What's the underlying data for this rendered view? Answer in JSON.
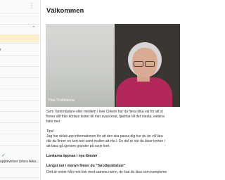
{
  "sidebar": {
    "more_menu": "⋮",
    "items": [
      {
        "label": ""
      },
      {
        "label": ""
      },
      {
        "label": ""
      },
      {
        "label": "r"
      },
      {
        "label": ""
      },
      {
        "label": ""
      },
      {
        "label": ""
      },
      {
        "label": ""
      },
      {
        "label": ""
      },
      {
        "label": ""
      },
      {
        "label": ""
      },
      {
        "label": "",
        "done": true
      },
      {
        "label": "upplevelser (stora Arka..."
      },
      {
        "label": ""
      },
      {
        "label": ""
      }
    ]
  },
  "page": {
    "title": "Välkommen",
    "video": {
      "caption": "Ylva Trollsterna"
    },
    "paragraphs": [
      "Som Tarotmästare eller medlem i Inre Cirkeln har du flera olika val för att st",
      "finner allt från kortare texter till mer avancerat, fjädrilar till det mesta, webina",
      "fatts mer.",
      "",
      "Tips!",
      "Jag har delat upp informationen för att den ska passa dig hur du än vill lära",
      "där du finner en kort text samt mallen att rita i. En del är när du läser korten i",
      "att bara gå igenom grunder på varje kort."
    ],
    "section_heading": "Lankarna öppnas i nya fönster",
    "subheading": "Längst ner i menyn finner du \"Tarotberättelser\"",
    "last_line": "Dett är texter från min bok med samma namn, de kan du läsa som kompleme"
  }
}
